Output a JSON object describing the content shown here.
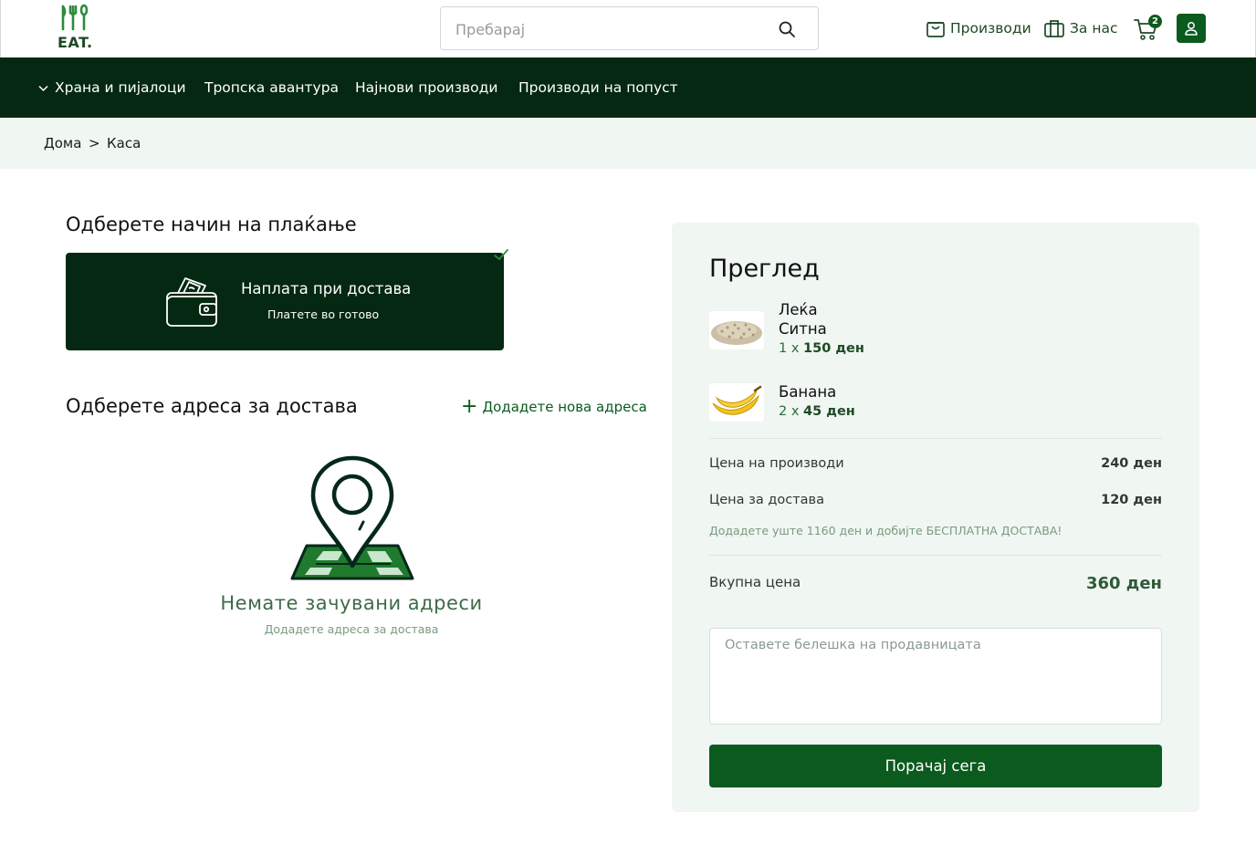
{
  "header": {
    "logo_text": "EAT.",
    "search_placeholder": "Пребарај",
    "nav_products": "Производи",
    "nav_about": "За нас",
    "cart_count": "2"
  },
  "main_nav": {
    "items": [
      "Храна и пијалоци",
      "Тропска авантура",
      "Најнови производи",
      "Производи на попуст"
    ]
  },
  "breadcrumb": {
    "home": "Дома",
    "separator": ">",
    "current": "Каса"
  },
  "payment": {
    "heading": "Одберете начин на плаќање",
    "option_title": "Наплата при достава",
    "option_subtitle": "Платете во готово",
    "selected": true
  },
  "address": {
    "heading": "Одберете адреса за достава",
    "add_label": "Додадете нова адреса",
    "empty_title": "Немате зачувани адреси",
    "empty_subtitle": "Додадете адреса за достава"
  },
  "summary": {
    "title": "Преглед",
    "items": [
      {
        "name_line1": "Леќа",
        "name_line2": "Ситна",
        "qty": "1 x",
        "price": "150 ден"
      },
      {
        "name_line1": "Банана",
        "name_line2": "",
        "qty": "2 x",
        "price": "45 ден"
      }
    ],
    "products_label": "Цена на производи",
    "products_value": "240 ден",
    "delivery_label": "Цена за достава",
    "delivery_value": "120 ден",
    "promo": "Додадете уште 1160 ден и добијте БЕСПЛАТНА ДОСТАВА!",
    "total_label": "Вкупна цена",
    "total_value": "360 ден",
    "note_placeholder": "Оставете белешка на продавницата",
    "order_button": "Порачај сега"
  },
  "colors": {
    "brand_dark": "#042812",
    "brand": "#0b5a1e",
    "light_bg": "#f0f6f2"
  }
}
